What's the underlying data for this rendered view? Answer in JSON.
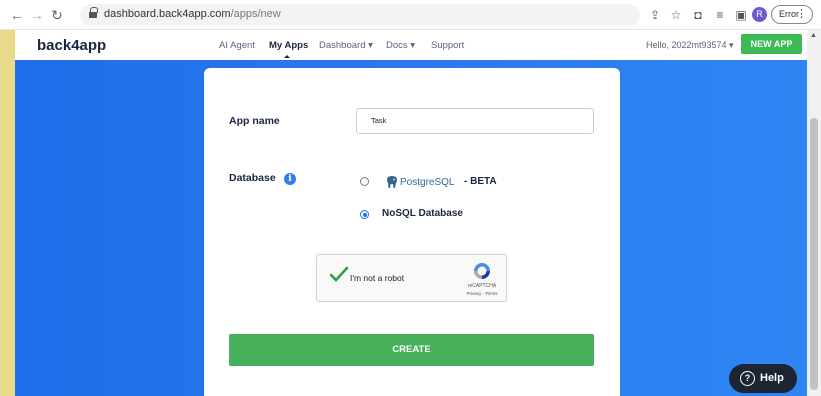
{
  "browser": {
    "url_host": "dashboard.back4app.com",
    "url_path": "/apps/new",
    "profile_initial": "R",
    "error_label": "Error"
  },
  "appbar": {
    "logo": "back4app",
    "nav": [
      {
        "label": "AI Agent"
      },
      {
        "label": "My Apps"
      },
      {
        "label": "Dashboard ▾"
      },
      {
        "label": "Docs ▾"
      },
      {
        "label": "Support"
      }
    ],
    "hello": "Hello, 2022mt93574 ▾",
    "new_app": "NEW APP"
  },
  "form": {
    "app_name_label": "App name",
    "app_name_value": "Task",
    "database_label": "Database",
    "options": [
      {
        "label": "PostgreSQL",
        "suffix": "- BETA",
        "selected": false
      },
      {
        "label": "NoSQL Database",
        "selected": true
      }
    ],
    "captcha": {
      "text": "I'm not a robot",
      "brand": "reCAPTCHA",
      "links": "Privacy - Terms"
    },
    "create": "CREATE"
  },
  "help": {
    "label": "Help"
  },
  "colors": {
    "brand_green": "#47b05a",
    "bg_blue": "#2a7bf0",
    "navy": "#1b2540"
  }
}
